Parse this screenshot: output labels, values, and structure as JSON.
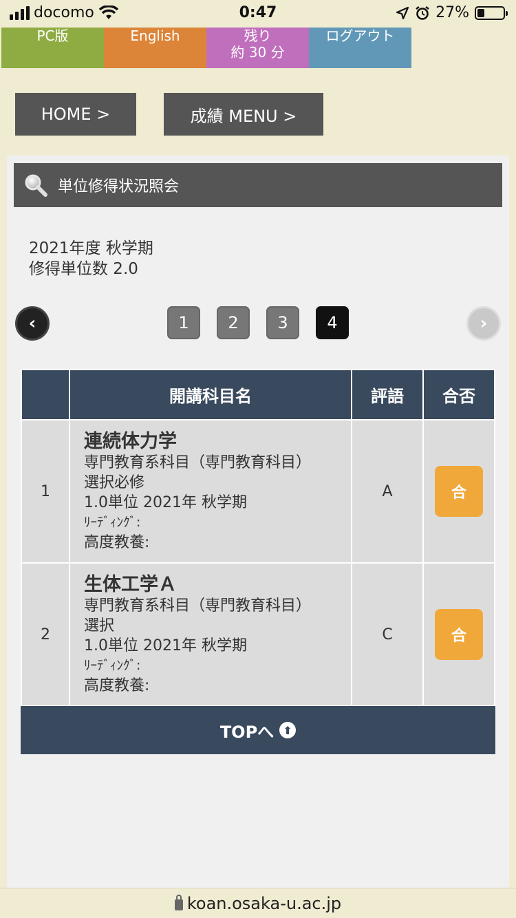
{
  "status_bar": {
    "carrier": "docomo",
    "time": "0:47",
    "battery": "27%",
    "battery_level": 0.27
  },
  "top_nav": {
    "items": [
      {
        "label": "PC版",
        "color": "#8fac43"
      },
      {
        "label": "English",
        "color": "#dc8438"
      },
      {
        "label_line1": "残り",
        "label_line2": "約 30 分",
        "color": "#c06fbd"
      },
      {
        "label": "ログアウト",
        "color": "#6298b7"
      }
    ]
  },
  "nav": {
    "home": "HOME >",
    "grades_menu": "成績 MENU >"
  },
  "panel": {
    "title": "単位修得状況照会",
    "term": "2021年度 秋学期",
    "credits": "修得単位数 2.0"
  },
  "pagination": {
    "prev": "‹",
    "next": "›",
    "pages": [
      "1",
      "2",
      "3",
      "4"
    ],
    "current": "4"
  },
  "table": {
    "headers": {
      "num": "",
      "course": "開講科目名",
      "eval": "評語",
      "pass": "合否"
    },
    "rows": [
      {
        "num": "1",
        "name": "連続体力学",
        "category": "専門教育系科目（専門教育科目）",
        "requirement": "選択必修",
        "credit_term": "1.0単位 2021年 秋学期",
        "reading": "ﾘｰﾃﾞｨﾝｸﾞ:",
        "liberal": "高度教養:",
        "eval": "A",
        "pass": "合"
      },
      {
        "num": "2",
        "name": "生体工学Ａ",
        "category": "専門教育系科目（専門教育科目）",
        "requirement": "選択",
        "credit_term": "1.0単位 2021年 秋学期",
        "reading": "ﾘｰﾃﾞｨﾝｸﾞ:",
        "liberal": "高度教養:",
        "eval": "C",
        "pass": "合"
      }
    ]
  },
  "top_link": "TOPへ",
  "url": "koan.osaka-u.ac.jp"
}
